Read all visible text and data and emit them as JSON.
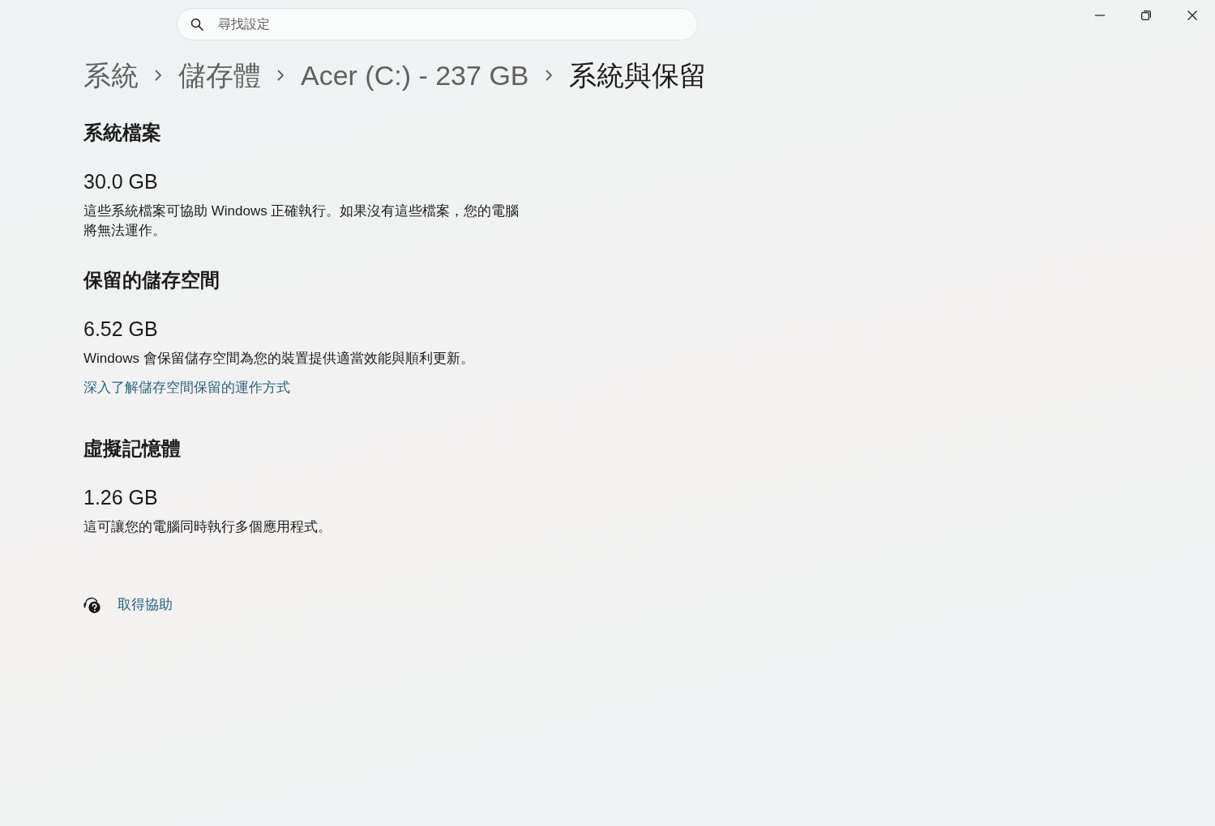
{
  "search": {
    "placeholder": "尋找設定"
  },
  "breadcrumb": [
    {
      "label": "系統",
      "current": false
    },
    {
      "label": "儲存體",
      "current": false
    },
    {
      "label": "Acer (C:) - 237 GB",
      "current": false
    },
    {
      "label": "系統與保留",
      "current": true
    }
  ],
  "sections": [
    {
      "title": "系統檔案",
      "size": "30.0 GB",
      "description": "這些系統檔案可協助 Windows 正確執行。如果沒有這些檔案，您的電腦將無法運作。"
    },
    {
      "title": "保留的儲存空間",
      "size": "6.52 GB",
      "description": "Windows 會保留儲存空間為您的裝置提供適當效能與順利更新。",
      "link": "深入了解儲存空間保留的運作方式"
    },
    {
      "title": "虛擬記憶體",
      "size": "1.26 GB",
      "description": "這可讓您的電腦同時執行多個應用程式。"
    }
  ],
  "help": {
    "label": "取得協助"
  }
}
